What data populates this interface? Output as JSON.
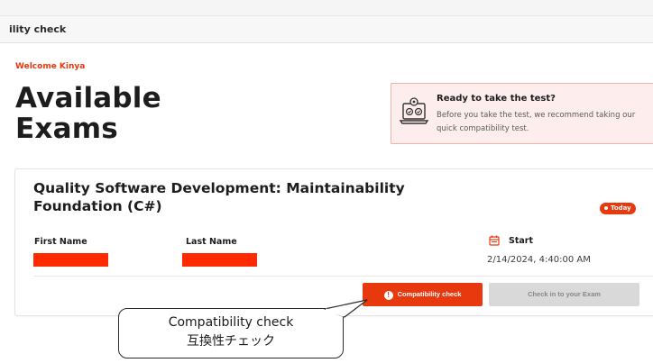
{
  "tab": {
    "title": "ility check"
  },
  "welcome": "Welcome Kinya",
  "page_title": "Available Exams",
  "ready_card": {
    "icon": "laptop-gear-icon",
    "title": "Ready to take the test?",
    "text": "Before you take the test, we recommend taking our quick compatibility test."
  },
  "exam": {
    "title": "Quality Software Development: Maintainability Foundation (C#)",
    "badge": "Today",
    "first_name_label": "First Name",
    "last_name_label": "Last Name",
    "start_label": "Start",
    "start_value": "2/14/2024, 4:40:00 AM",
    "compat_button": "Compatibility check",
    "checkin_button": "Check in to your Exam"
  },
  "callout": {
    "line1": "Compatibility check",
    "line2": "互換性チェック"
  },
  "colors": {
    "accent": "#e8380d",
    "redaction": "#ff2a00",
    "ready_bg": "#fdeeed",
    "disabled_button": "#d9d9d9"
  }
}
